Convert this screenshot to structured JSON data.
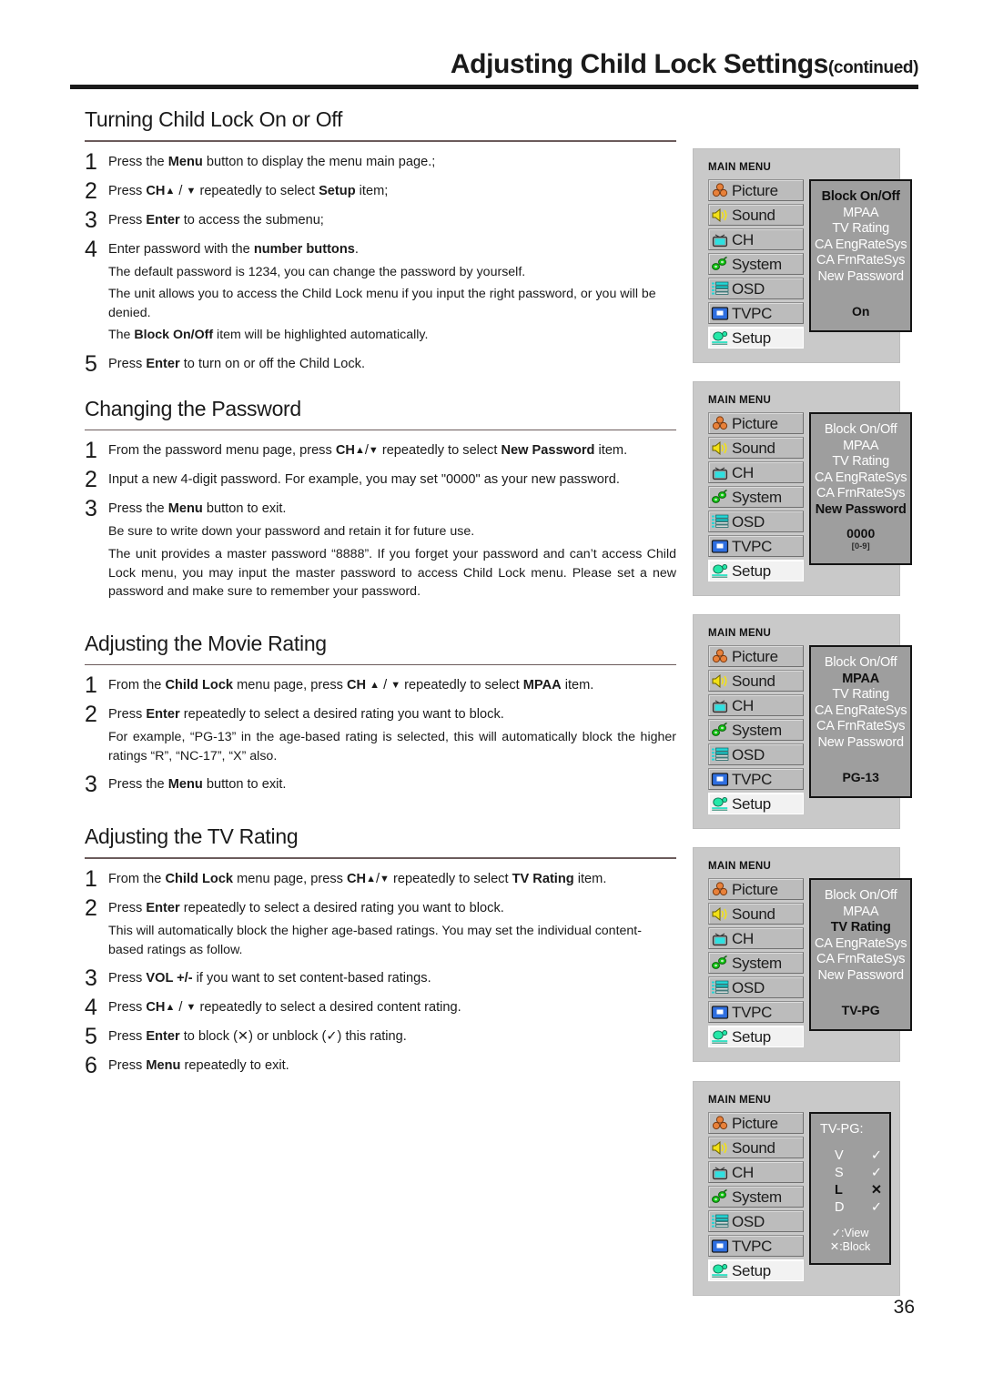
{
  "header": {
    "title": "Adjusting Child Lock Settings",
    "continued": "(continued)"
  },
  "page_number": "36",
  "sections": [
    {
      "heading": "Turning Child Lock On or Off",
      "steps": [
        {
          "num": "1",
          "text_html": "Press  the <b>Menu</b> button to display the menu main  page.;"
        },
        {
          "num": "2",
          "text_html": "Press <b>CH</b><span class=\"arr\">▲</span> / <span class=\"arr\">▼</span> repeatedly to select <b>Setup</b>  item;"
        },
        {
          "num": "3",
          "text_html": "Press <b>Enter</b> to access the submenu;"
        },
        {
          "num": "4",
          "text_html": "Enter password with the <b>number buttons</b>.",
          "notes_html": [
            "The default password is 1234, you can change the password by yourself.",
            "The unit allows you to access the Child Lock menu if you input the right password, or you will be denied.",
            "The <b>Block On/Off</b> item will be highlighted automatically."
          ]
        },
        {
          "num": "5",
          "text_html": "Press <b>Enter</b> to turn on or off the Child Lock."
        }
      ]
    },
    {
      "heading": "Changing the Password",
      "steps": [
        {
          "num": "1",
          "text_html": "From the password menu page, press <b>CH</b><span class=\"arr\">▲</span>/<span class=\"arr\">▼</span> repeatedly to select <b>New Password</b> item.",
          "justify": true
        },
        {
          "num": "2",
          "text_html": "Input a new 4-digit password. For example, you may set \"0000\" as your new password.",
          "justify": true
        },
        {
          "num": "3",
          "text_html": "Press the <b>Menu</b>  button to exit.",
          "notes_html": [
            "Be sure to write down your password and retain it for future use.",
            "The unit provides a master password “8888”. If you forget your password and can’t access Child Lock menu, you may input the master password to access Child Lock menu. Please set a new password and make sure to remember your password."
          ]
        }
      ]
    },
    {
      "heading": "Adjusting the Movie Rating",
      "steps": [
        {
          "num": "1",
          "text_html": "From the <b>Child Lock</b> menu page, press <b>CH</b> <span class=\"arr\">▲</span> / <span class=\"arr\">▼</span> repeatedly to select <b>MPAA</b> item."
        },
        {
          "num": "2",
          "text_html": "Press <b>Enter</b> repeatedly to select a desired rating you want to block.",
          "notes_html": [
            "For example, “PG-13” in the age-based rating is selected, this will automatically block the higher ratings “R”, “NC-17”, “X” also."
          ]
        },
        {
          "num": "3",
          "text_html": "Press the <b>Menu</b>  button to exit."
        }
      ]
    },
    {
      "heading": "Adjusting the TV Rating",
      "steps": [
        {
          "num": "1",
          "text_html": "From the <b>Child Lock</b> menu page, press <b>CH</b><span class=\"arr\">▲</span>/<span class=\"arr\">▼</span> repeatedly to select <b>TV Rating</b> item.",
          "justify": true
        },
        {
          "num": "2",
          "text_html": "Press <b>Enter</b> repeatedly to select a desired rating you want to block.",
          "notes_html": [
            "This will automatically block the higher age-based ratings. You may set the individual content-based ratings as follow."
          ]
        },
        {
          "num": "3",
          "text_html": "Press <b>VOL +/-</b>  if you want to set content-based ratings."
        },
        {
          "num": "4",
          "text_html": "Press <b>CH</b><span class=\"arr\">▲</span> / <span class=\"arr\">▼</span> repeatedly to select a desired content rating."
        },
        {
          "num": "5",
          "text_html": "Press <b>Enter</b> to block (✕)  or unblock (✓) this rating."
        },
        {
          "num": "6",
          "text_html": "Press <b>Menu</b> repeatedly to exit."
        }
      ]
    }
  ],
  "osd": {
    "main_menu_title": "MAIN MENU",
    "menu_items": [
      {
        "label": "Picture",
        "icon": "picture-icon"
      },
      {
        "label": "Sound",
        "icon": "sound-icon"
      },
      {
        "label": "CH",
        "icon": "channel-icon"
      },
      {
        "label": "System",
        "icon": "system-icon"
      },
      {
        "label": "OSD",
        "icon": "osd-icon"
      },
      {
        "label": "TVPC",
        "icon": "tvpc-icon"
      },
      {
        "label": "Setup",
        "icon": "setup-icon"
      }
    ],
    "selected_menu_item": "Setup",
    "submenu_items": [
      "Block On/Off",
      "MPAA",
      "TV Rating",
      "CA EngRateSys",
      "CA FrnRateSys",
      "New Password"
    ],
    "panels": [
      {
        "name": "block-on-off-panel",
        "active": "Block On/Off",
        "value": "On",
        "hint": ""
      },
      {
        "name": "new-password-panel",
        "active": "New Password",
        "value": "0000",
        "hint": "[0-9]"
      },
      {
        "name": "mpaa-panel",
        "active": "MPAA",
        "value": "PG-13",
        "hint": ""
      },
      {
        "name": "tv-rating-panel",
        "active": "TV Rating",
        "value": "TV-PG",
        "hint": ""
      }
    ],
    "content_rating_panel": {
      "name": "content-rating-panel",
      "title": "TV-PG:",
      "rows": [
        {
          "letter": "V",
          "mark": "✓",
          "active": false
        },
        {
          "letter": "S",
          "mark": "✓",
          "active": false
        },
        {
          "letter": "L",
          "mark": "✕",
          "active": true
        },
        {
          "letter": "D",
          "mark": "✓",
          "active": false
        }
      ],
      "legend": "✓:View ✕:Block"
    }
  },
  "colors": {
    "panel_bg": "#c9c9c9",
    "submenu_bg": "#9e9e9e",
    "menu_item_bg": "#bcbcbc",
    "selected_bg": "#f2f2f2"
  }
}
